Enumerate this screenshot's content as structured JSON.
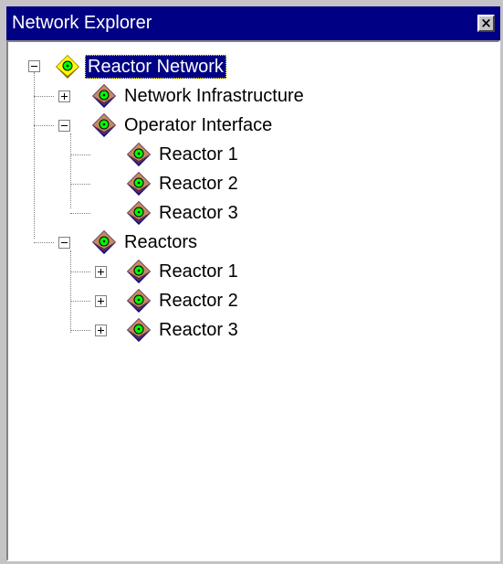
{
  "window": {
    "title": "Network Explorer",
    "close_glyph": "×"
  },
  "tree": {
    "root": {
      "label": "Reactor Network",
      "expanded": true,
      "selected": true,
      "icon": "yellow-diamond-node-icon"
    },
    "items": [
      {
        "label": "Network Infrastructure",
        "level": 1,
        "expanded": false,
        "has_children": true,
        "icon": "blue-diamond-node-icon"
      },
      {
        "label": "Operator Interface",
        "level": 1,
        "expanded": true,
        "has_children": true,
        "icon": "blue-diamond-node-icon"
      },
      {
        "label": "Reactor 1",
        "level": 2,
        "has_children": false,
        "icon": "blue-diamond-node-icon"
      },
      {
        "label": "Reactor 2",
        "level": 2,
        "has_children": false,
        "icon": "blue-diamond-node-icon"
      },
      {
        "label": "Reactor 3",
        "level": 2,
        "has_children": false,
        "icon": "blue-diamond-node-icon"
      },
      {
        "label": "Reactors",
        "level": 1,
        "expanded": true,
        "has_children": true,
        "icon": "blue-diamond-node-icon"
      },
      {
        "label": "Reactor 1",
        "level": 2,
        "expanded": false,
        "has_children": true,
        "icon": "blue-diamond-node-icon"
      },
      {
        "label": "Reactor 2",
        "level": 2,
        "expanded": false,
        "has_children": true,
        "icon": "blue-diamond-node-icon"
      },
      {
        "label": "Reactor 3",
        "level": 2,
        "expanded": false,
        "has_children": true,
        "icon": "blue-diamond-node-icon"
      }
    ]
  },
  "colors": {
    "title_bar": "#000084",
    "selection": "#000084",
    "node_diamond": "#000084",
    "root_diamond": "#ffff00",
    "node_center": "#00ff00"
  }
}
